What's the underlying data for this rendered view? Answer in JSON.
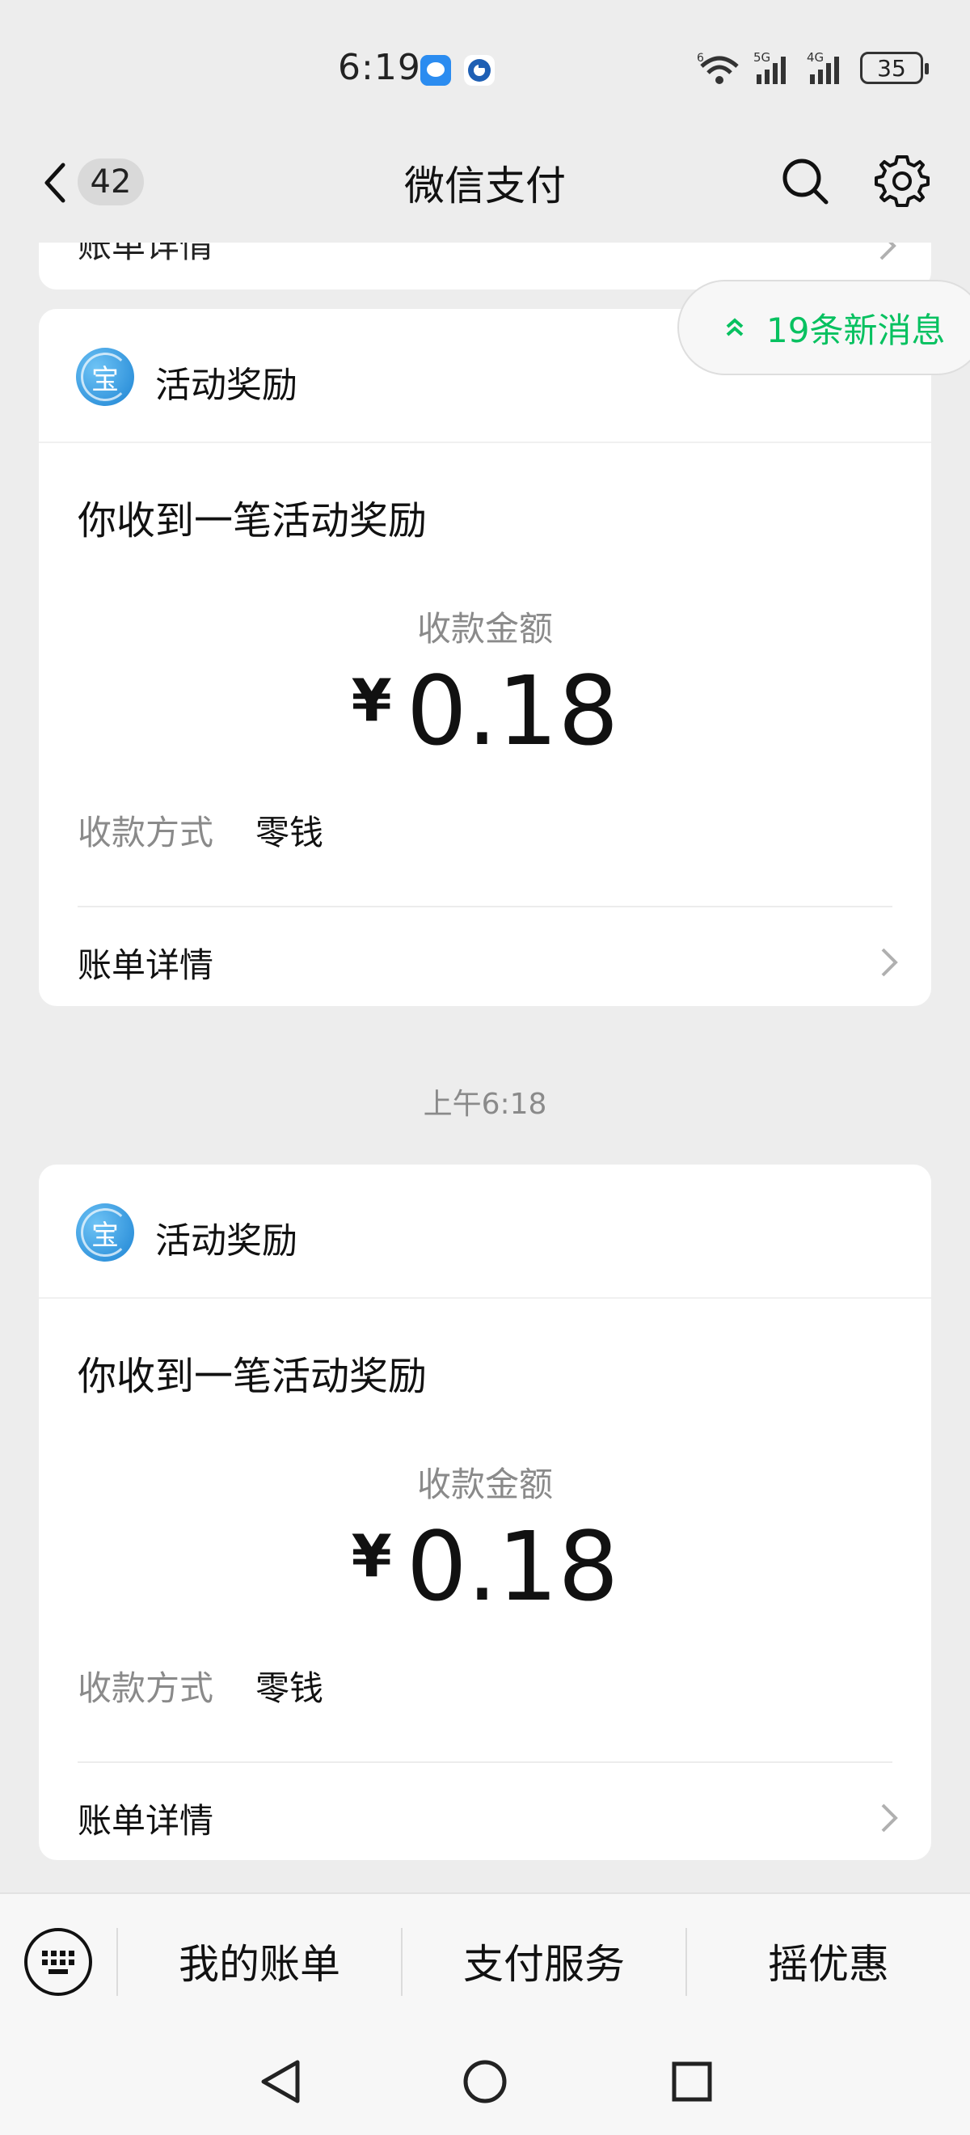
{
  "status_bar": {
    "time": "6:19",
    "network_labels": [
      "6",
      "5G",
      "4G"
    ],
    "battery": "35"
  },
  "nav": {
    "unread_count": "42",
    "title": "微信支付"
  },
  "new_messages": {
    "label": "19条新消息",
    "accent": "#07c160"
  },
  "cards": [
    {
      "brand": "活动奖励",
      "headline": "你收到一笔活动奖励",
      "amount_label": "收款金额",
      "currency": "¥",
      "amount": "0.18",
      "method_label": "收款方式",
      "method_value": "零钱",
      "detail_label": "账单详情"
    },
    {
      "brand": "活动奖励",
      "headline": "你收到一笔活动奖励",
      "amount_label": "收款金额",
      "currency": "¥",
      "amount": "0.18",
      "method_label": "收款方式",
      "method_value": "零钱",
      "detail_label": "账单详情"
    }
  ],
  "partial_card": {
    "detail_label": "账单详情"
  },
  "timestamp": "上午6:18",
  "brand_logo_text": "宝",
  "bottom_menu": {
    "items": [
      "我的账单",
      "支付服务",
      "摇优惠"
    ]
  }
}
